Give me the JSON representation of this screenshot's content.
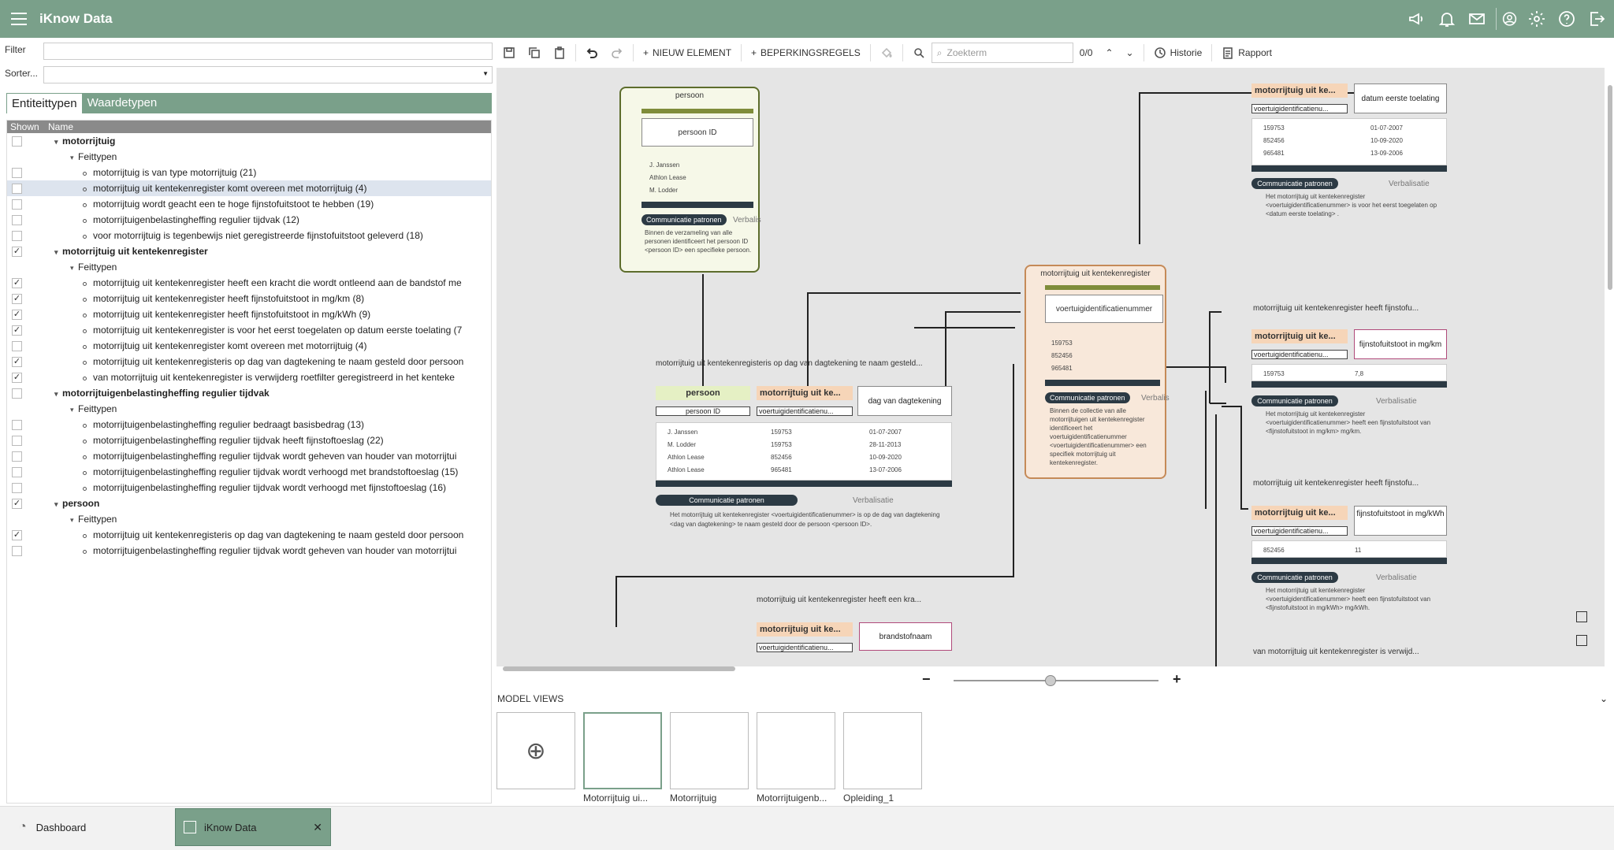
{
  "app": {
    "title": "iKnow Data"
  },
  "left": {
    "filter_label": "Filter",
    "sort_label": "Sorter...",
    "tabs": [
      "Entiteittypen",
      "Waardetypen"
    ],
    "col_shown": "Shown",
    "col_name": "Name",
    "rows": [
      {
        "level": 0,
        "text": "motorrijtuig",
        "checked": false
      },
      {
        "level": 1,
        "text": "Feittypen",
        "checked": null
      },
      {
        "level": 2,
        "text": "motorrijtuig is van type motorrijtuig (21)",
        "checked": false
      },
      {
        "level": 2,
        "text": "motorrijtuig uit kentekenregister komt overeen met motorrijtuig (4)",
        "checked": false,
        "selected": true
      },
      {
        "level": 2,
        "text": "motorrijtuig wordt geacht een te hoge fijnstofuitstoot te hebben (19)",
        "checked": false
      },
      {
        "level": 2,
        "text": "motorrijtuigenbelastingheffing regulier tijdvak (12)",
        "checked": false
      },
      {
        "level": 2,
        "text": "voor motorrijtuig is tegenbewijs niet geregistreerde fijnstofuitstoot geleverd (18)",
        "checked": false
      },
      {
        "level": 0,
        "text": "motorrijtuig uit kentekenregister",
        "checked": true
      },
      {
        "level": 1,
        "text": "Feittypen",
        "checked": null
      },
      {
        "level": 2,
        "text": "motorrijtuig uit kentekenregister heeft een kracht die wordt ontleend aan de bandstof me",
        "checked": true
      },
      {
        "level": 2,
        "text": "motorrijtuig uit kentekenregister heeft fijnstofuitstoot in mg/km (8)",
        "checked": true
      },
      {
        "level": 2,
        "text": "motorrijtuig uit kentekenregister heeft fijnstofuitstoot in mg/kWh (9)",
        "checked": true
      },
      {
        "level": 2,
        "text": "motorrijtuig uit kentekenregister is voor het eerst toegelaten op datum eerste toelating (7",
        "checked": true
      },
      {
        "level": 2,
        "text": "motorrijtuig uit kentekenregister komt overeen met motorrijtuig (4)",
        "checked": false
      },
      {
        "level": 2,
        "text": "motorrijtuig uit kentekenregisteris op dag van dagtekening te naam gesteld door persoon",
        "checked": true
      },
      {
        "level": 2,
        "text": "van motorrijtuig uit kentekenregister is verwijderg roetfilter geregistreerd in het kenteke",
        "checked": true
      },
      {
        "level": 0,
        "text": "motorrijtuigenbelastingheffing regulier tijdvak",
        "checked": false
      },
      {
        "level": 1,
        "text": "Feittypen",
        "checked": null
      },
      {
        "level": 2,
        "text": "motorrijtuigenbelastingheffing regulier bedraagt basisbedrag (13)",
        "checked": false
      },
      {
        "level": 2,
        "text": "motorrijtuigenbelastingheffing regulier tijdvak heeft fijnstoftoeslag (22)",
        "checked": false
      },
      {
        "level": 2,
        "text": "motorrijtuigenbelastingheffing regulier tijdvak wordt geheven van houder van motorrijtui",
        "checked": false
      },
      {
        "level": 2,
        "text": "motorrijtuigenbelastingheffing regulier tijdvak wordt verhoogd met brandstoftoeslag (15)",
        "checked": false
      },
      {
        "level": 2,
        "text": "motorrijtuigenbelastingheffing regulier tijdvak wordt verhoogd met fijnstoftoeslag (16)",
        "checked": false
      },
      {
        "level": 0,
        "text": "persoon",
        "checked": true
      },
      {
        "level": 1,
        "text": "Feittypen",
        "checked": null
      },
      {
        "level": 2,
        "text": "motorrijtuig uit kentekenregisteris op dag van dagtekening te naam gesteld door persoon",
        "checked": true
      },
      {
        "level": 2,
        "text": "motorrijtuigenbelastingheffing regulier tijdvak wordt geheven van houder van motorrijtui",
        "checked": false
      }
    ]
  },
  "toolbar": {
    "new_element": "NIEUW ELEMENT",
    "constraints": "BEPERKINGSREGELS",
    "search_placeholder": "Zoekterm",
    "search_count": "0/0",
    "history": "Historie",
    "report": "Rapport"
  },
  "canvas": {
    "persoon": {
      "title": "persoon",
      "id_label": "persoon ID",
      "values": [
        "J. Janssen",
        "Athlon Lease",
        "M. Lodder"
      ],
      "pill": "Communicatie patronen",
      "pill2": "Verbalis",
      "text": "Binnen de verzameling van alle personen identificeert het persoon ID <persoon ID> een specifieke persoon."
    },
    "mk": {
      "title": "motorrijtuig uit kentekenregister",
      "id_label": "voertuigidentificatienummer",
      "values": [
        "159753",
        "852456",
        "965481"
      ],
      "pill": "Communicatie patronen",
      "pill2": "Verbalis",
      "text": "Binnen de collectie van alle motorrijtuigen uit kentekenregister identificeert het voertuigidentificatienummer <voertuigidentificatienummer> een specifiek motorrijtuig uit kentekenregister."
    },
    "ft1": {
      "header": "motorrijtuig uit kentekenregisteris op dag van dagtekening te naam gesteld...",
      "r1": "persoon",
      "r2": "motorrijtuig uit ke...",
      "r3": "dag van dagtekening",
      "u1": "persoon ID",
      "u2": "voertuigidentificatienu...",
      "rows": [
        [
          "J. Janssen",
          "159753",
          "01-07-2007"
        ],
        [
          "M. Lodder",
          "159753",
          "28-11-2013"
        ],
        [
          "Athlon Lease",
          "852456",
          "10-09-2020"
        ],
        [
          "Athlon Lease",
          "965481",
          "13-07-2006"
        ]
      ],
      "pill": "Communicatie patronen",
      "pill2": "Verbalisatie",
      "text": "Het motorrijtuig uit kentekenregister <voertuigidentificatienummer> is op de dag van dagtekening <dag van dagtekening> te naam gesteld door de persoon <persoon ID>."
    },
    "ft2": {
      "header": "motorrijtuig uit kentekenregister heeft een kra...",
      "r1": "motorrijtuig uit ke...",
      "r2": "brandstofnaam",
      "u1": "voertuigidentificatienu..."
    },
    "ft3": {
      "r1": "motorrijtuig uit ke...",
      "r2": "datum eerste toelating",
      "u1": "voertuigidentificatienu...",
      "rows": [
        [
          "159753",
          "01-07-2007"
        ],
        [
          "852456",
          "10-09-2020"
        ],
        [
          "965481",
          "13-09-2006"
        ]
      ],
      "pill": "Communicatie patronen",
      "pill2": "Verbalisatie",
      "text": "Het motorrijtuig uit kentekenregister <voertuigidentificatienummer> is voor het eerst toegelaten op <datum eerste toelating> ."
    },
    "ft4": {
      "header": "motorrijtuig uit kentekenregister heeft fijnstofu...",
      "r1": "motorrijtuig uit ke...",
      "r2": "fijnstofuitstoot in mg/km",
      "u1": "voertuigidentificatienu...",
      "rows": [
        [
          "159753",
          "7,8"
        ]
      ],
      "pill": "Communicatie patronen",
      "pill2": "Verbalisatie",
      "text": "Het motorrijtuig uit kentekenregister <voertuigidentificatienummer> heeft een fijnstofuitstoot van <fijnstofuitstoot in mg/km> mg/km."
    },
    "ft5": {
      "header": "motorrijtuig uit kentekenregister heeft fijnstofu...",
      "r1": "motorrijtuig uit ke...",
      "r2": "fijnstofuitstoot in mg/kWh",
      "u1": "voertuigidentificatienu...",
      "rows": [
        [
          "852456",
          "11"
        ]
      ],
      "pill": "Communicatie patronen",
      "pill2": "Verbalisatie",
      "text": "Het motorrijtuig uit kentekenregister <voertuigidentificatienummer> heeft een fijnstofuitstoot van <fijnstofuitstoot in mg/kWh> mg/kWh."
    },
    "ft6": {
      "header": "van motorrijtuig uit kentekenregister is verwijd..."
    }
  },
  "modelviews": {
    "title": "MODEL VIEWS",
    "items": [
      "Motorrijtuig ui...",
      "Motorrijtuig",
      "Motorrijtuigenb...",
      "Opleiding_1"
    ]
  },
  "bottom": {
    "dashboard": "Dashboard",
    "app": "iKnow Data"
  }
}
